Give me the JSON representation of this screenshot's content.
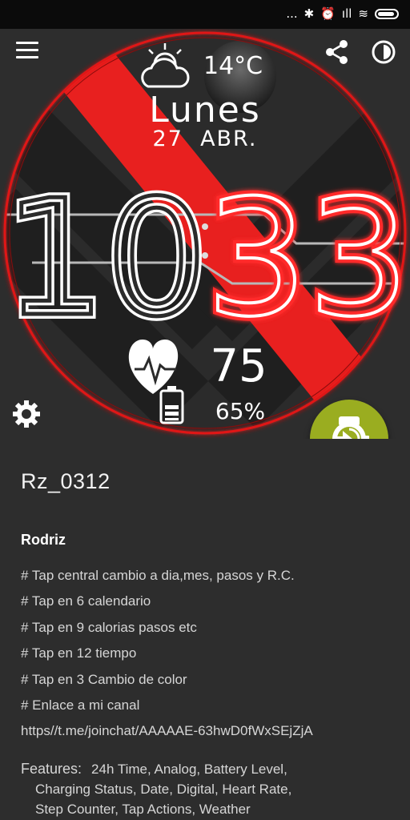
{
  "statusbar": {
    "dots": "...",
    "bluetooth": "✱",
    "alarm": "⏰",
    "signal": "ıll",
    "wifi": "≋"
  },
  "watchface": {
    "weather_temp": "14°C",
    "day": "Lunes",
    "date": "27  ABR.",
    "hour": "10",
    "minute": "33",
    "heart_rate": "75",
    "battery": "65%",
    "colors": {
      "accent": "#ff2a2a",
      "ring": "#e01818"
    }
  },
  "fab": {
    "icon": "watch-install-icon",
    "color": "#9aad20"
  },
  "details": {
    "title": "Rz_0312",
    "author": "Rodriz",
    "description": [
      "# Tap central cambio a dia,mes,  pasos y R.C.",
      "# Tap en 6 calendario",
      "# Tap en 9 calorias pasos etc",
      "# Tap en 12 tiempo",
      "# Tap en 3 Cambio de color",
      "# Enlace a mi canal",
      "https//t.me/joinchat/AAAAAE-63hwD0fWxSEjZjA"
    ],
    "features_label": "Features:",
    "features_line1": "24h Time,  Analog,  Battery Level,",
    "features_line2": "Charging Status,  Date,  Digital,  Heart Rate,",
    "features_line3": "Step Counter,  Tap Actions,  Weather"
  }
}
